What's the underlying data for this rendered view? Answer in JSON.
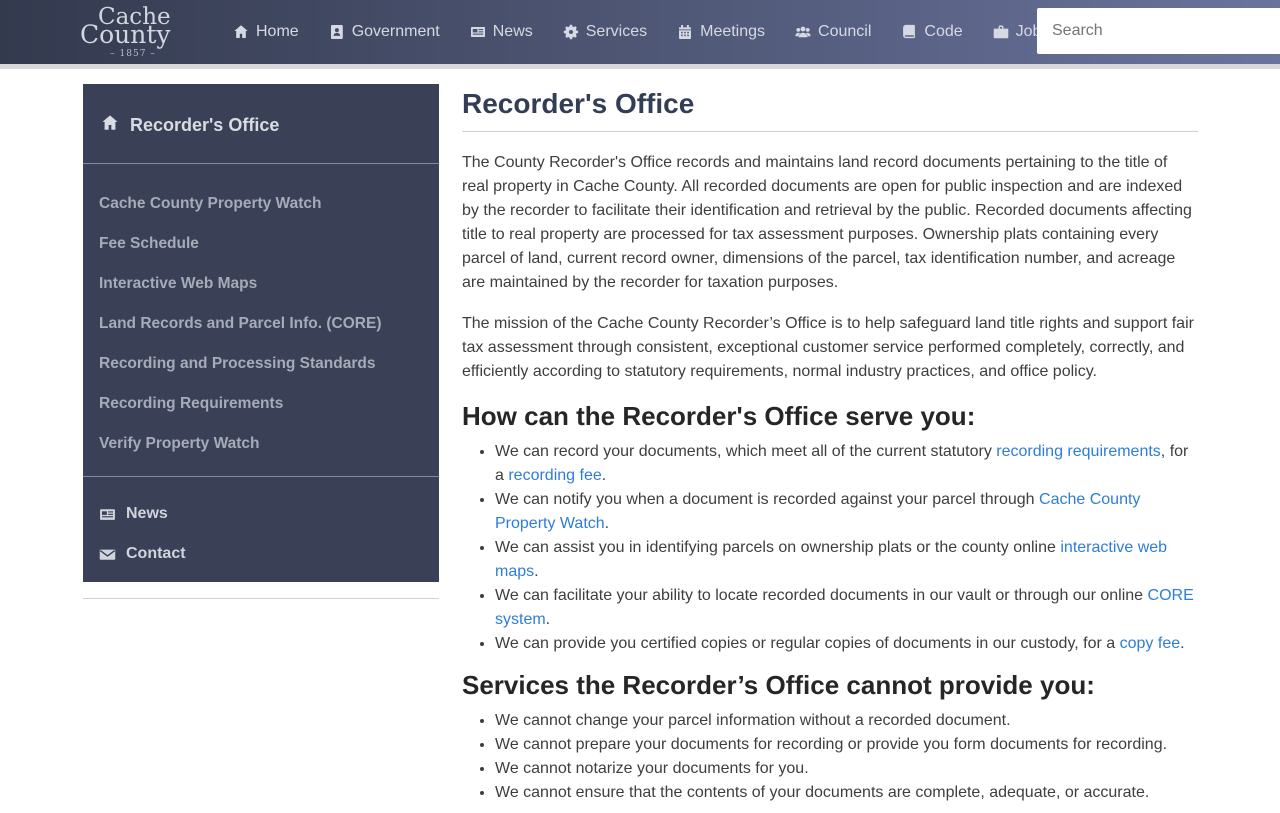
{
  "navbar": {
    "logo": {
      "line1": "Cache",
      "line2": "County",
      "year": "– 1857 –"
    },
    "items": [
      {
        "label": "Home",
        "icon": "home-icon"
      },
      {
        "label": "Government",
        "icon": "address-book-icon"
      },
      {
        "label": "News",
        "icon": "newspaper-icon"
      },
      {
        "label": "Services",
        "icon": "gear-icon"
      },
      {
        "label": "Meetings",
        "icon": "calendar-icon"
      },
      {
        "label": "Council",
        "icon": "users-icon"
      },
      {
        "label": "Code",
        "icon": "book-icon"
      },
      {
        "label": "Jobs",
        "icon": "briefcase-icon"
      }
    ],
    "search_placeholder": "Search"
  },
  "sidebar": {
    "title": "Recorder's Office",
    "title_icon": "home-icon",
    "links": [
      "Cache County Property Watch",
      "Fee Schedule",
      "Interactive Web Maps",
      "Land Records and Parcel Info. (CORE)",
      "Recording and Processing Standards",
      "Recording Requirements",
      "Verify Property Watch"
    ],
    "secondary": [
      {
        "label": "News",
        "icon": "newspaper-icon"
      },
      {
        "label": "Contact",
        "icon": "envelope-icon"
      }
    ]
  },
  "main": {
    "title": "Recorder's Office",
    "paragraphs": [
      "The County Recorder's Office records and maintains land record documents pertaining to the title of real property in Cache County. All recorded documents are open for public inspection and are indexed by the recorder to facilitate their identification and retrieval by the public. Recorded documents affecting title to real property are processed for tax assessment purposes. Ownership plats containing every parcel of land, current record owner, dimensions of the parcel, tax identification number, and acreage are maintained by the recorder for taxation purposes.",
      "The mission of the Cache County Recorder’s Office is to help safeguard land title rights and support fair tax assessment through consistent, exceptional customer service performed completely, correctly, and efficiently according to statutory requirements, normal industry practices, and office policy."
    ],
    "sections": [
      {
        "heading": "How can the Recorder's Office serve you:",
        "items": [
          [
            {
              "t": "We can record your documents, which meet all of the current statutory "
            },
            {
              "t": "recording requirements",
              "link": true
            },
            {
              "t": ", for a "
            },
            {
              "t": "recording fee",
              "link": true
            },
            {
              "t": "."
            }
          ],
          [
            {
              "t": "We can notify you when a document is recorded against your parcel through "
            },
            {
              "t": "Cache County Property Watch",
              "link": true
            },
            {
              "t": "."
            }
          ],
          [
            {
              "t": "We can assist you in identifying parcels on ownership plats or the county online "
            },
            {
              "t": "interactive web maps",
              "link": true
            },
            {
              "t": "."
            }
          ],
          [
            {
              "t": "We can facilitate your ability to locate recorded documents in our vault or through our online "
            },
            {
              "t": "CORE system",
              "link": true
            },
            {
              "t": "."
            }
          ],
          [
            {
              "t": "We can provide you certified copies or regular copies of documents in our custody, for a "
            },
            {
              "t": "copy fee",
              "link": true
            },
            {
              "t": "."
            }
          ]
        ]
      },
      {
        "heading": "Services the Recorder’s Office cannot provide you:",
        "items": [
          [
            {
              "t": "We cannot change your parcel information without a recorded document."
            }
          ],
          [
            {
              "t": "We cannot prepare your documents for recording or provide you form documents for recording."
            }
          ],
          [
            {
              "t": "We cannot notarize your documents for you."
            }
          ],
          [
            {
              "t": "We cannot ensure that the contents of your documents are complete, adequate, or accurate."
            }
          ]
        ]
      }
    ]
  },
  "colors": {
    "navbar_gradient_left": "#333a4e",
    "navbar_gradient_right": "#6a739c",
    "sidebar_background": "#3a4157",
    "link_blue": "#2e7ddb",
    "heading_navy": "#333d55",
    "body_text": "#3e3e3e"
  }
}
